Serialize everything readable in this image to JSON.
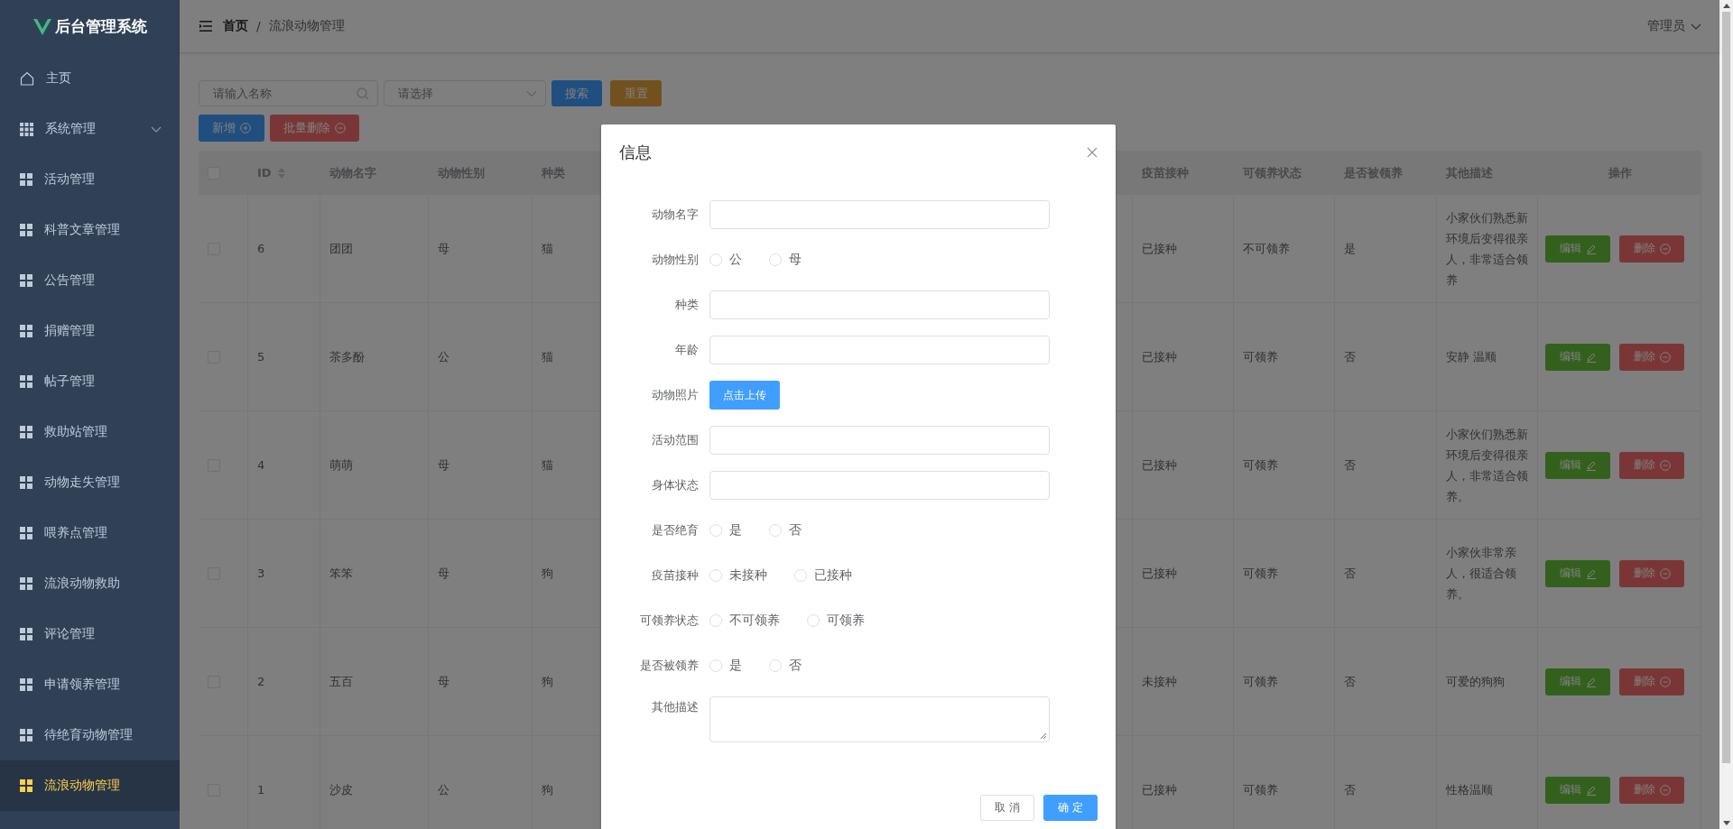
{
  "sidebar": {
    "logo_text": "后台管理系统",
    "items": [
      {
        "label": "主页",
        "kind": "home",
        "selected": false
      },
      {
        "label": "系统管理",
        "kind": "submenu",
        "selected": false
      },
      {
        "label": "活动管理",
        "kind": "item",
        "selected": false
      },
      {
        "label": "科普文章管理",
        "kind": "item",
        "selected": false
      },
      {
        "label": "公告管理",
        "kind": "item",
        "selected": false
      },
      {
        "label": "捐赠管理",
        "kind": "item",
        "selected": false
      },
      {
        "label": "帖子管理",
        "kind": "item",
        "selected": false
      },
      {
        "label": "救助站管理",
        "kind": "item",
        "selected": false
      },
      {
        "label": "动物走失管理",
        "kind": "item",
        "selected": false
      },
      {
        "label": "喂养点管理",
        "kind": "item",
        "selected": false
      },
      {
        "label": "流浪动物救助",
        "kind": "item",
        "selected": false
      },
      {
        "label": "评论管理",
        "kind": "item",
        "selected": false
      },
      {
        "label": "申请领养管理",
        "kind": "item",
        "selected": false
      },
      {
        "label": "待绝育动物管理",
        "kind": "item",
        "selected": false
      },
      {
        "label": "流浪动物管理",
        "kind": "item",
        "selected": true
      }
    ]
  },
  "header": {
    "breadcrumb": [
      "首页",
      "流浪动物管理"
    ],
    "separator": "/",
    "user": "管理员"
  },
  "toolbar": {
    "search": {
      "placeholder": "请输入名称"
    },
    "select": {
      "placeholder": "请选择"
    },
    "buttons": [
      {
        "label": "搜索",
        "kind": "search"
      },
      {
        "label": "重置",
        "kind": "reset"
      }
    ],
    "actions": [
      {
        "label": "新增",
        "kind": "add"
      },
      {
        "label": "批量删除",
        "kind": "batch_delete"
      }
    ]
  },
  "table": {
    "select_all": {
      "checked": false
    },
    "columns": [
      {
        "kind": "text",
        "label": "ID",
        "sortable": true
      },
      {
        "kind": "text",
        "label": "动物名字",
        "sortable": false
      },
      {
        "kind": "text",
        "label": "动物性别",
        "sortable": false
      },
      {
        "kind": "text",
        "label": "种类",
        "sortable": false
      },
      {
        "kind": "text",
        "label": "疫苗接种",
        "sortable": false
      },
      {
        "kind": "text",
        "label": "可领养状态",
        "sortable": false
      },
      {
        "kind": "text",
        "label": "是否被领养",
        "sortable": false
      },
      {
        "kind": "text",
        "label": "其他描述",
        "sortable": false
      },
      {
        "kind": "actions",
        "label": "操作",
        "sortable": false
      }
    ],
    "rows": [
      {
        "checked": false,
        "cells": [
          "6",
          "团团",
          "母",
          "猫",
          "已接种",
          "不可领养",
          "是",
          "小家伙们熟悉新环境后变得很亲人，非常适合领养"
        ],
        "actions": [
          {
            "label": "编辑",
            "kind": "edit"
          },
          {
            "label": "删除",
            "kind": "delete"
          }
        ]
      },
      {
        "checked": false,
        "cells": [
          "5",
          "茶多酚",
          "公",
          "猫",
          "已接种",
          "可领养",
          "否",
          "安静 温顺"
        ],
        "actions": [
          {
            "label": "编辑",
            "kind": "edit"
          },
          {
            "label": "删除",
            "kind": "delete"
          }
        ]
      },
      {
        "checked": false,
        "cells": [
          "4",
          "萌萌",
          "母",
          "猫",
          "已接种",
          "可领养",
          "否",
          "小家伙们熟悉新环境后变得很亲人，非常适合领养。"
        ],
        "actions": [
          {
            "label": "编辑",
            "kind": "edit"
          },
          {
            "label": "删除",
            "kind": "delete"
          }
        ]
      },
      {
        "checked": false,
        "cells": [
          "3",
          "笨笨",
          "母",
          "狗",
          "已接种",
          "可领养",
          "否",
          "小家伙非常亲人，很适合领养。"
        ],
        "actions": [
          {
            "label": "编辑",
            "kind": "edit"
          },
          {
            "label": "删除",
            "kind": "delete"
          }
        ]
      },
      {
        "checked": false,
        "cells": [
          "2",
          "五百",
          "母",
          "狗",
          "未接种",
          "可领养",
          "否",
          "可爱的狗狗"
        ],
        "actions": [
          {
            "label": "编辑",
            "kind": "edit"
          },
          {
            "label": "删除",
            "kind": "delete"
          }
        ]
      },
      {
        "checked": false,
        "cells": [
          "1",
          "沙皮",
          "公",
          "狗",
          "已接种",
          "可领养",
          "否",
          "性格温顺"
        ],
        "actions": [
          {
            "label": "编辑",
            "kind": "edit"
          },
          {
            "label": "删除",
            "kind": "delete"
          }
        ]
      }
    ]
  },
  "dialog": {
    "title": "信息",
    "fields": [
      {
        "label": "动物名字",
        "kind": "input"
      },
      {
        "label": "动物性别",
        "kind": "radio",
        "options": [
          {
            "label": "公",
            "selected": false
          },
          {
            "label": "母",
            "selected": false
          }
        ]
      },
      {
        "label": "种类",
        "kind": "input"
      },
      {
        "label": "年龄",
        "kind": "input"
      },
      {
        "label": "动物照片",
        "kind": "upload",
        "button": "点击上传"
      },
      {
        "label": "活动范围",
        "kind": "input"
      },
      {
        "label": "身体状态",
        "kind": "input"
      },
      {
        "label": "是否绝育",
        "kind": "radio",
        "options": [
          {
            "label": "是",
            "selected": false
          },
          {
            "label": "否",
            "selected": false
          }
        ]
      },
      {
        "label": "疫苗接种",
        "kind": "radio",
        "options": [
          {
            "label": "未接种",
            "selected": false
          },
          {
            "label": "已接种",
            "selected": false
          }
        ]
      },
      {
        "label": "可领养状态",
        "kind": "radio",
        "options": [
          {
            "label": "不可领养",
            "selected": false
          },
          {
            "label": "可领养",
            "selected": false
          }
        ]
      },
      {
        "label": "是否被领养",
        "kind": "radio",
        "options": [
          {
            "label": "是",
            "selected": false
          },
          {
            "label": "否",
            "selected": false
          }
        ]
      },
      {
        "label": "其他描述",
        "kind": "textarea"
      }
    ],
    "buttons": [
      {
        "label": "取 消",
        "kind": "cancel"
      },
      {
        "label": "确 定",
        "kind": "confirm"
      }
    ]
  }
}
